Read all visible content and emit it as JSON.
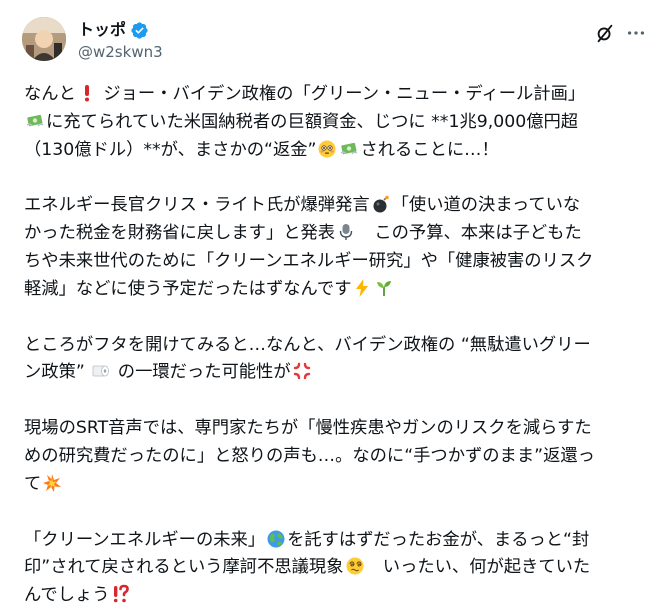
{
  "header": {
    "display_name": "トッポ",
    "handle": "@w2skwn3"
  },
  "icons": {
    "verified": "verified-badge-icon",
    "grok": "grok-icon",
    "more": "more-icon"
  },
  "colors": {
    "verified_blue": "#1d9bf0",
    "text": "#0f1419",
    "secondary": "#536471"
  },
  "post": {
    "p1": {
      "l1a": "なんと",
      "l1b": " ジョー・バイデン政権の「グリーン・ニュー・ディール計画」",
      "l2a": "に充てられていた米国納税者の巨額資金、じつに **1兆9,000億円超",
      "l3a": "（130億ドル）**が、まさかの“返金”",
      "l3b": "されることに…！"
    },
    "p2": {
      "l1a": "エネルギー長官クリス・ライト氏が爆弾発言",
      "l1b": "「使い道の決まっていな",
      "l2a": "かった税金を財務省に戻します」と発表",
      "l2b": "　この予算、本来は子どもた",
      "l3a": "ちや未来世代のために「クリーンエネルギー研究」や「健康被害のリスク",
      "l4a": "軽減」などに使う予定だったはずなんです"
    },
    "p3": {
      "l1a": "ところがフタを開けてみると…なんと、バイデン政権の “無駄遣いグリー",
      "l2a": "ン政策” ",
      "l2b": " の一環だった可能性が"
    },
    "p4": {
      "l1a": "現場のSRT音声では、専門家たちが「慢性疾患やガンのリスクを減らすた",
      "l2a": "めの研究費だったのに」と怒りの声も…。なのに“手つかずのまま”返還っ",
      "l3a": "て"
    },
    "p5": {
      "l1a": "「クリーンエネルギーの未来」",
      "l1b": "を託すはずだったお金が、まるっと“封",
      "l2a": "印”されて戻されるという摩訶不思議現象",
      "l2b": "　いったい、何が起きていた",
      "l3a": "んでしょう"
    }
  },
  "emoji": {
    "exclamation": "red-exclamation-icon",
    "money": "money-with-wings-icon",
    "flushed": "flushed-face-icon",
    "bomb": "bomb-icon",
    "microphone": "microphone-icon",
    "lightning": "high-voltage-icon",
    "seedling": "seedling-icon",
    "toilet_paper": "toilet-paper-icon",
    "anger": "anger-symbol-icon",
    "collision": "collision-icon",
    "earth": "earth-globe-icon",
    "dizzy_face": "face-with-spiral-eyes-icon",
    "interrobang": "exclamation-question-icon"
  }
}
